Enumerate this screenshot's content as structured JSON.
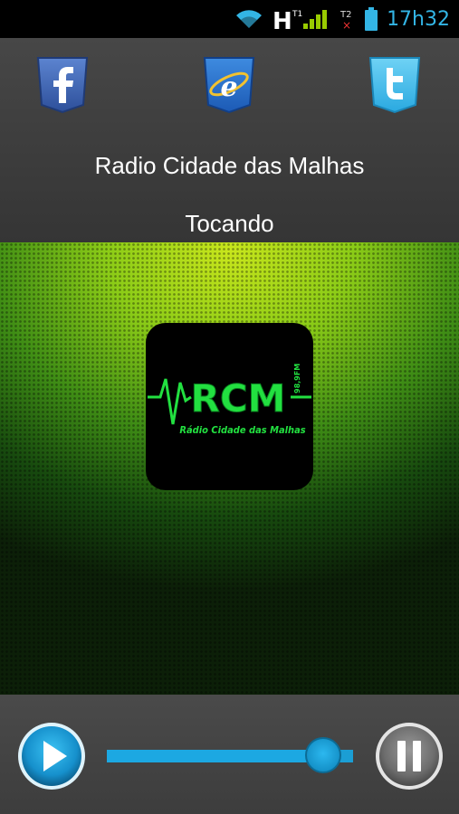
{
  "status_bar": {
    "network": "H",
    "time": "17h32",
    "accent_color": "#33b5e5",
    "icons": [
      "wifi-icon",
      "signal-icon",
      "sim2-no-signal-icon",
      "battery-icon"
    ]
  },
  "header": {
    "social": [
      {
        "name": "facebook-icon"
      },
      {
        "name": "internet-explorer-icon"
      },
      {
        "name": "twitter-icon"
      }
    ],
    "station_name": "Radio Cidade das Malhas",
    "status": "Tocando"
  },
  "artwork": {
    "logo_text": "RCM",
    "logo_side_text": "98,9FM",
    "logo_subtitle": "Rádio Cidade das Malhas",
    "logo_color": "#22e040"
  },
  "player": {
    "play_icon": "play-icon",
    "pause_icon": "pause-icon",
    "volume_level": 0.88,
    "accent_color": "#1ca8e2"
  }
}
